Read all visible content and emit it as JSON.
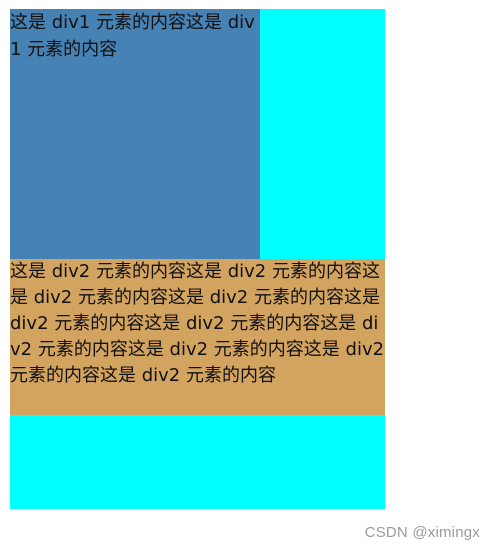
{
  "div1": {
    "text": "这是 div1 元素的内容这是 div1 元素的内容",
    "background": "#4682b4"
  },
  "div2": {
    "text": "这是 div2 元素的内容这是 div2 元素的内容这是 div2 元素的内容这是 div2 元素的内容这是 div2 元素的内容这是 div2 元素的内容这是 div2 元素的内容这是 div2 元素的内容这是 div2 元素的内容这是 div2 元素的内容",
    "background": "#d2a460"
  },
  "container": {
    "background": "#00ffff"
  },
  "watermark": {
    "text": "CSDN @ximingx"
  }
}
